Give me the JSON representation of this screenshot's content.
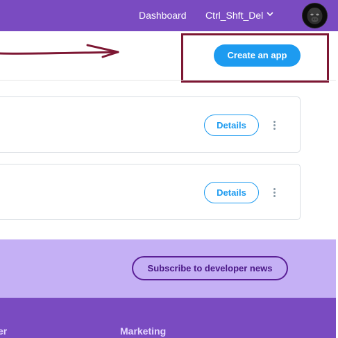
{
  "nav": {
    "dashboard_label": "Dashboard",
    "user_label": "Ctrl_Shft_Del",
    "chevron_icon": "chevron-down-icon",
    "avatar_icon": "avatar"
  },
  "header": {
    "create_label": "Create an app",
    "annotation": {
      "arrow_color": "#7d1733",
      "highlight_color": "#7d1733"
    }
  },
  "apps": [
    {
      "details_label": "Details",
      "menu_icon": "more-vertical-icon"
    },
    {
      "details_label": "Details",
      "menu_icon": "more-vertical-icon"
    }
  ],
  "subscribe": {
    "button_label": "Subscribe to developer news"
  },
  "footer": {
    "headings": [
      "er",
      "Marketing"
    ]
  },
  "colors": {
    "nav_bg": "#7a4bc1",
    "accent_blue": "#1d9bf0",
    "subscribe_bg": "#c5b0f5",
    "subscribe_text": "#4a1786"
  }
}
